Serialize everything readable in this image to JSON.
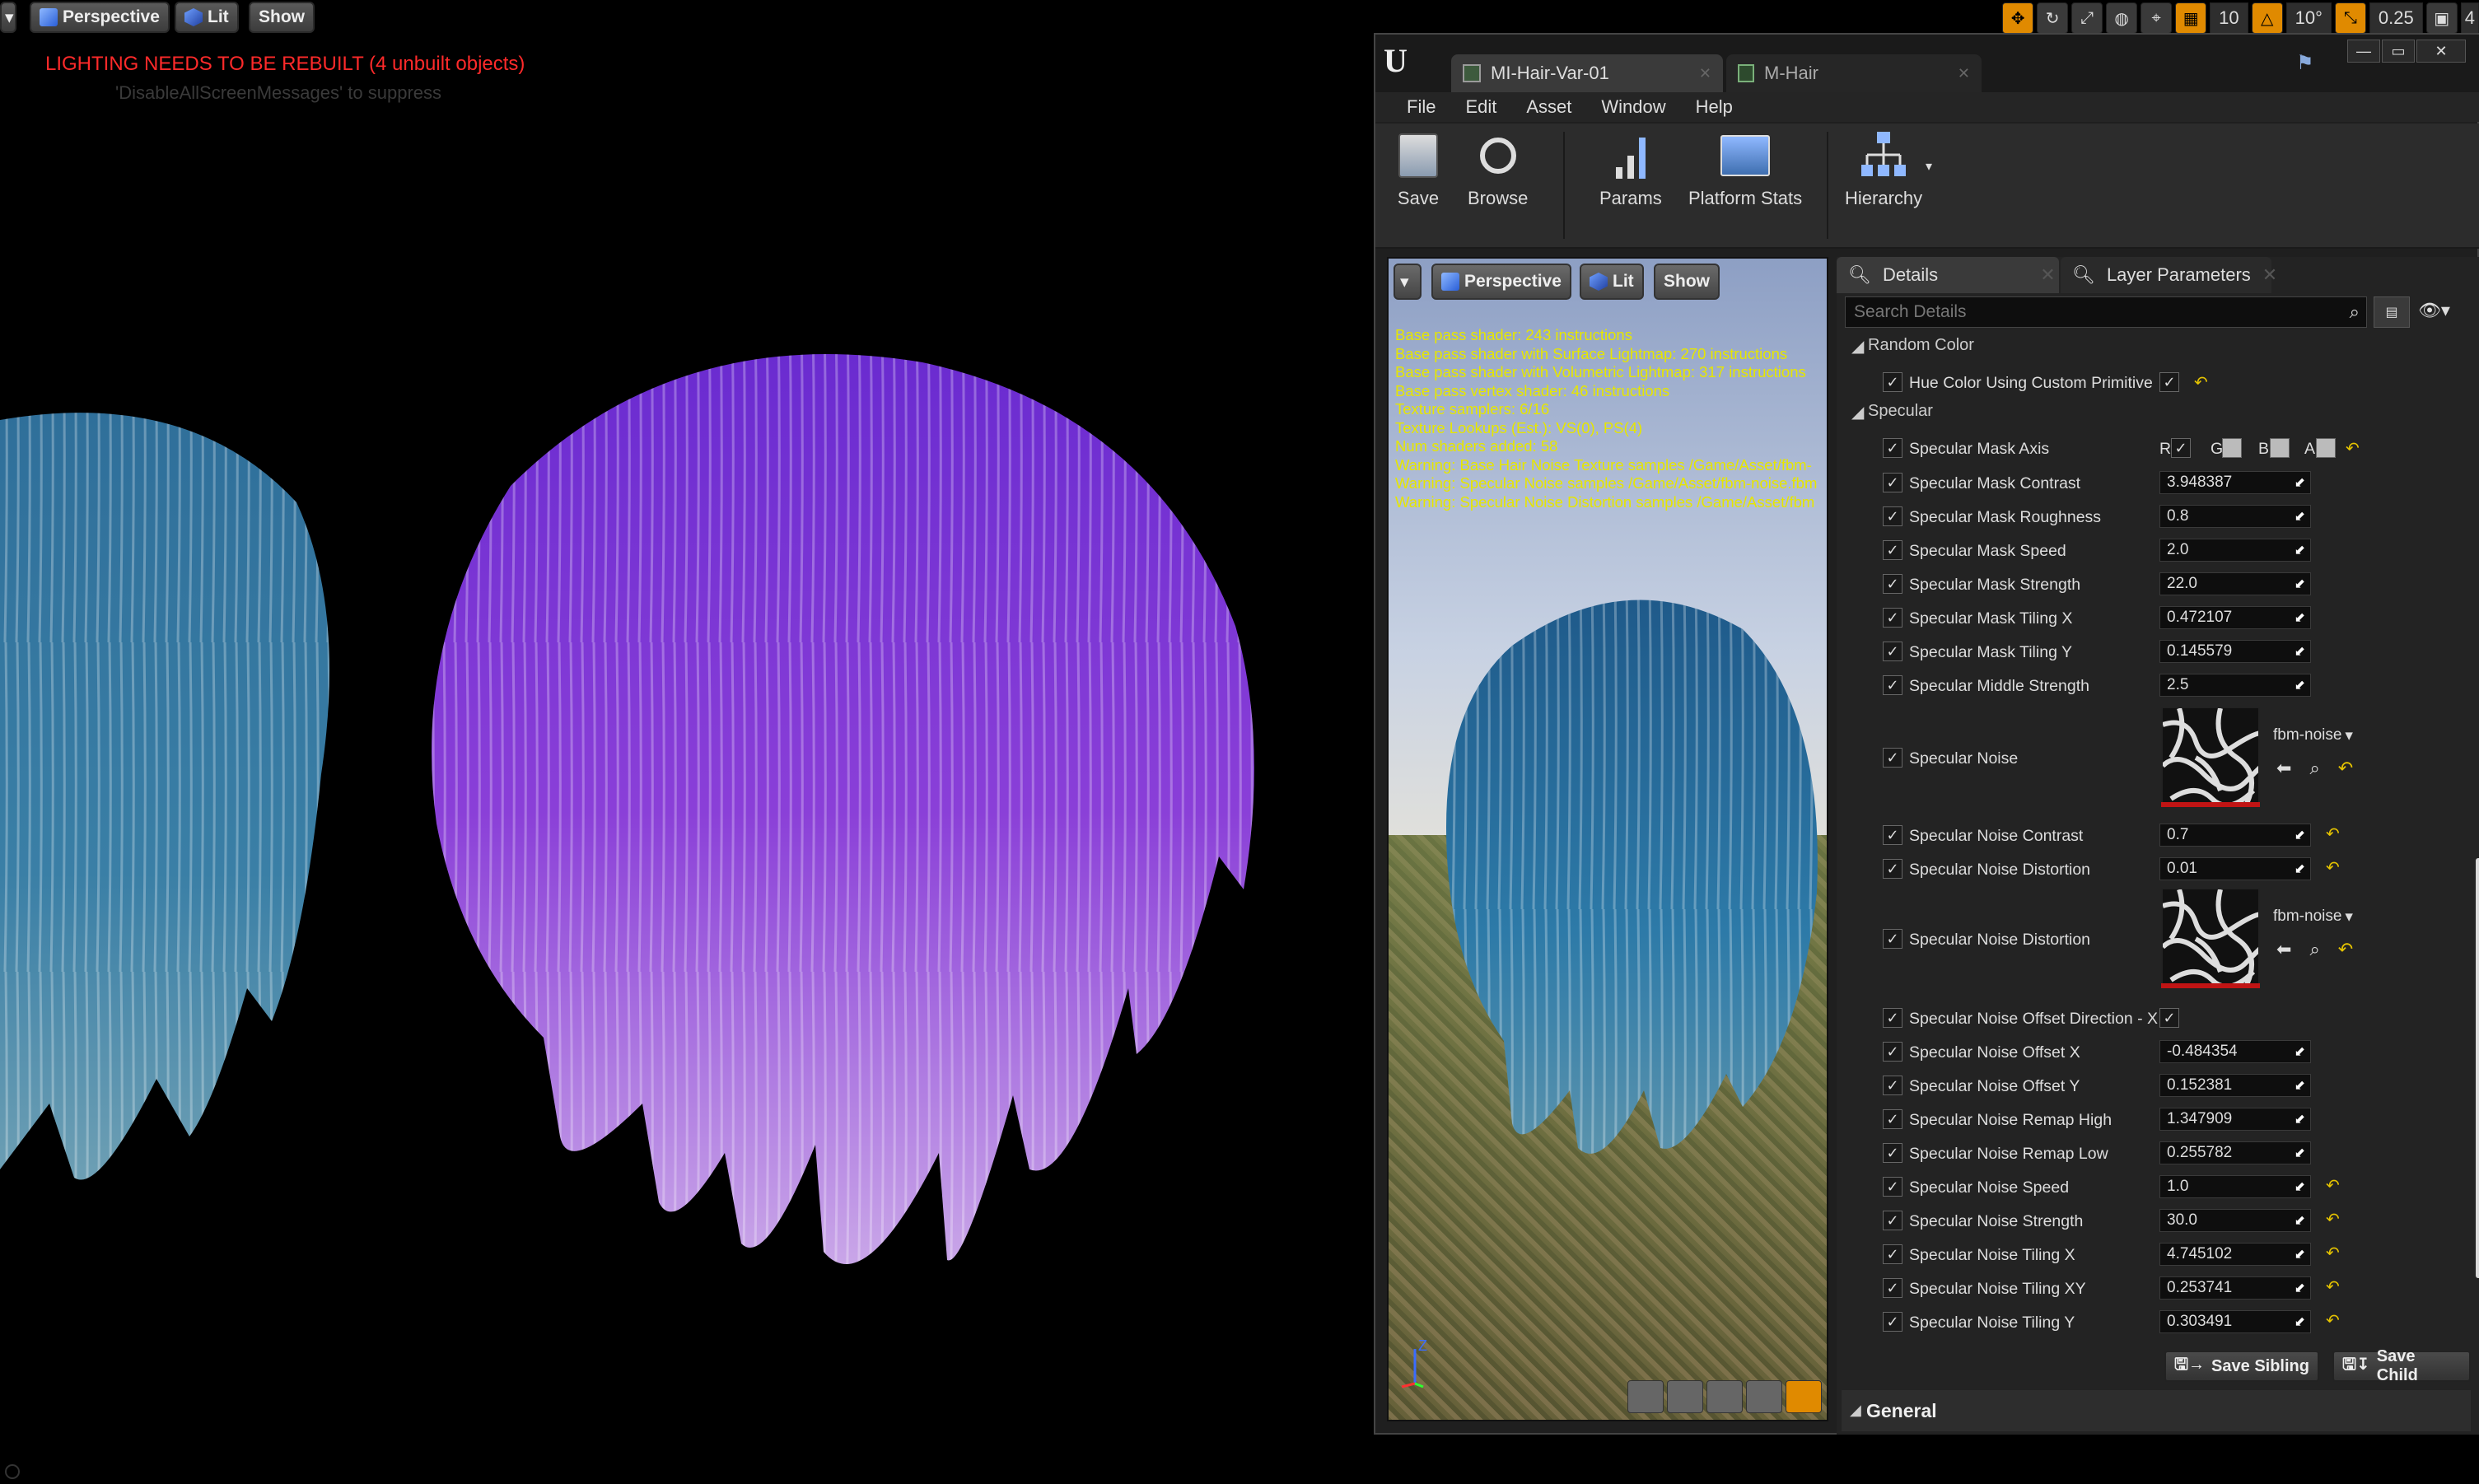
{
  "viewport": {
    "perspective": "Perspective",
    "lit": "Lit",
    "show": "Show",
    "warning": "LIGHTING NEEDS TO BE REBUILT (4 unbuilt objects)",
    "suppress": "'DisableAllScreenMessages' to suppress",
    "top_values": [
      "10",
      "10°",
      "0.25",
      "4"
    ]
  },
  "editor": {
    "tabs": [
      {
        "label": "MI-Hair-Var-01",
        "active": true
      },
      {
        "label": "M-Hair",
        "active": false
      }
    ],
    "menu": [
      "File",
      "Edit",
      "Asset",
      "Window",
      "Help"
    ],
    "toolbar": {
      "save": "Save",
      "browse": "Browse",
      "params": "Params",
      "platform_stats": "Platform Stats",
      "hierarchy": "Hierarchy"
    },
    "preview": {
      "perspective": "Perspective",
      "lit": "Lit",
      "show": "Show",
      "stats": [
        "Base pass shader: 243 instructions",
        "Base pass shader with Surface Lightmap: 270 instructions",
        "Base pass shader with Volumetric Lightmap: 317 instructions",
        "Base pass vertex shader: 46 instructions",
        "Texture samplers: 6/16",
        "Texture Lookups (Est.): VS(0), PS(4)",
        "Num shaders added: 58",
        "Warning: Base Hair Noise Texture samples /Game/Asset/fbm-",
        "Warning: Specular Noise samples /Game/Asset/fbm-noise.fbm",
        "Warning: Specular Noise Distortion  samples /Game/Asset/fbm"
      ]
    },
    "details": {
      "tab_details": "Details",
      "tab_layers": "Layer Parameters",
      "search_placeholder": "Search Details",
      "cat_random": "Random Color",
      "hue_label": "Hue Color Using Custom Primitive",
      "cat_specular": "Specular",
      "mask_axis": "Specular Mask Axis",
      "channels": [
        "R",
        "G",
        "B",
        "A"
      ],
      "params": [
        {
          "label": "Specular Mask Contrast",
          "value": "3.948387"
        },
        {
          "label": "Specular Mask Roughness",
          "value": "0.8"
        },
        {
          "label": "Specular Mask Speed",
          "value": "2.0"
        },
        {
          "label": "Specular Mask Strength",
          "value": "22.0"
        },
        {
          "label": "Specular Mask Tiling X",
          "value": "0.472107"
        },
        {
          "label": "Specular Mask Tiling Y",
          "value": "0.145579"
        },
        {
          "label": "Specular Middle Strength",
          "value": "2.5"
        }
      ],
      "noise_label": "Specular Noise",
      "noise_tex": "fbm-noise",
      "noise_contrast": {
        "label": "Specular Noise Contrast",
        "value": "0.7"
      },
      "noise_distortion": {
        "label": "Specular Noise Distortion",
        "value": "0.01"
      },
      "noise_distortion_tex_label": "Specular Noise Distortion",
      "noise_distortion_tex": "fbm-noise",
      "offset_dir": "Specular Noise Offset Direction - X",
      "params2": [
        {
          "label": "Specular Noise Offset X",
          "value": "-0.484354",
          "reset": false
        },
        {
          "label": "Specular Noise Offset Y",
          "value": "0.152381",
          "reset": false
        },
        {
          "label": "Specular Noise Remap High",
          "value": "1.347909",
          "reset": false
        },
        {
          "label": "Specular Noise Remap Low",
          "value": "0.255782",
          "reset": false
        },
        {
          "label": "Specular Noise Speed",
          "value": "1.0",
          "reset": true
        },
        {
          "label": "Specular Noise Strength",
          "value": "30.0",
          "reset": true
        },
        {
          "label": "Specular Noise Tiling X",
          "value": "4.745102",
          "reset": true
        },
        {
          "label": "Specular Noise Tiling XY",
          "value": "0.253741",
          "reset": true
        },
        {
          "label": "Specular Noise Tiling Y",
          "value": "0.303491",
          "reset": true
        }
      ],
      "save_sibling": "Save Sibling",
      "save_child": "Save Child",
      "cat_general": "General"
    }
  }
}
